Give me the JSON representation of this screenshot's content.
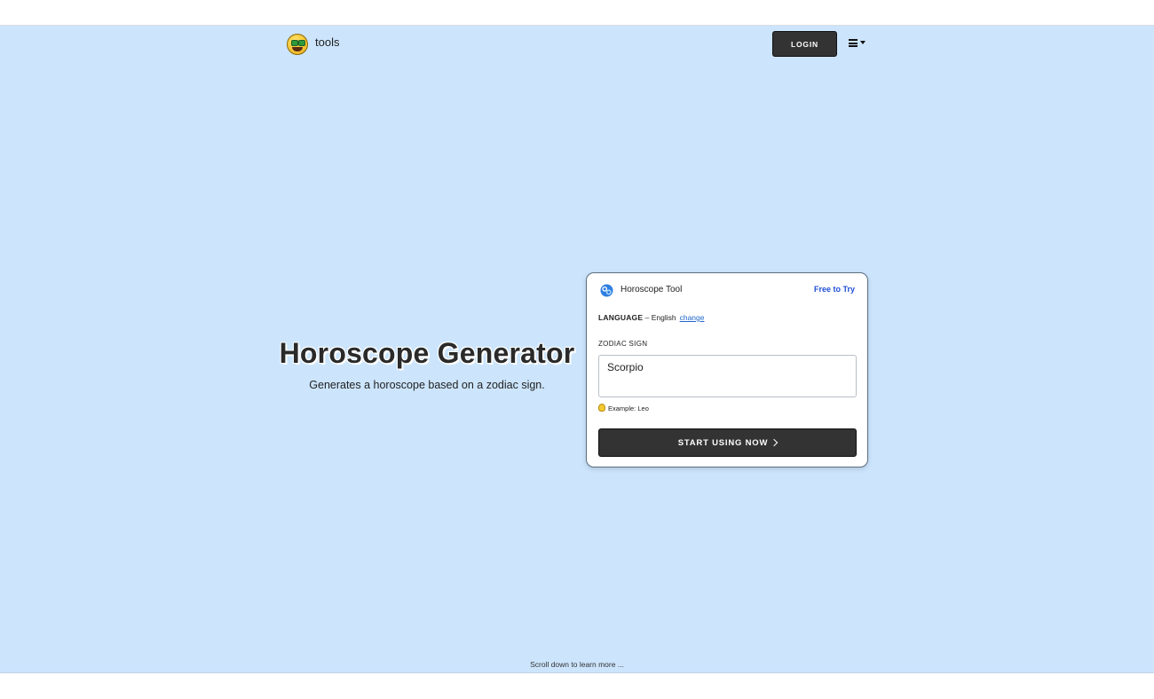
{
  "header": {
    "logo_text": "tools",
    "login_label": "LOGIN"
  },
  "hero": {
    "title": "Horoscope Generator",
    "subtitle": "Generates a horoscope based on a zodiac sign."
  },
  "tool_card": {
    "tool_name": "Horoscope Tool",
    "badge": "Free to Try",
    "language_key": "LANGUAGE",
    "language_separator": " – ",
    "language_value": "English",
    "change_link": "change",
    "field_label": "ZODIAC SIGN",
    "field_value": "Scorpio",
    "example_hint": "Example: Leo",
    "start_label": "START USING NOW"
  },
  "footer": {
    "scroll_hint": "Scroll down to learn more ..."
  },
  "colors": {
    "hero_background": "#cce5fd",
    "button_dark": "#333333",
    "link_blue": "#1f66c9",
    "badge_blue": "#1f4fd6"
  },
  "icons": {
    "logo": "money-mouth-face-icon",
    "menu": "hamburger-menu-icon",
    "tool": "horoscope-tool-icon",
    "hint": "lightbulb-icon",
    "start": "chevron-right-icon"
  }
}
